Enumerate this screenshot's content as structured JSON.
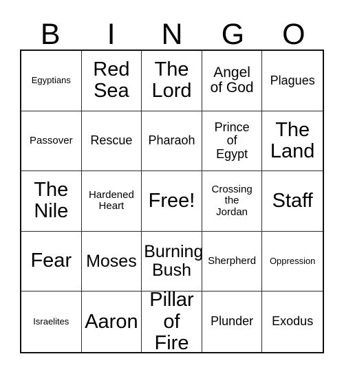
{
  "card": {
    "headers": [
      "B",
      "I",
      "N",
      "G",
      "O"
    ],
    "columns": 5,
    "rows": 5,
    "free_space_label": "Free!",
    "free_space_index": 12,
    "colors": {
      "background": "#ffffff",
      "text": "#000000",
      "outer_border": "#111111",
      "inner_border": "#2b2b2b"
    },
    "cells": [
      {
        "text": "Egyptians",
        "size": "xs"
      },
      {
        "text": "Red\nSea",
        "size": "xxl"
      },
      {
        "text": "The\nLord",
        "size": "xxl"
      },
      {
        "text": "Angel\nof God",
        "size": "lg"
      },
      {
        "text": "Plagues",
        "size": "md"
      },
      {
        "text": "Passover",
        "size": "sm"
      },
      {
        "text": "Rescue",
        "size": "md"
      },
      {
        "text": "Pharaoh",
        "size": "md"
      },
      {
        "text": "Prince\nof\nEgypt",
        "size": "md"
      },
      {
        "text": "The\nLand",
        "size": "xxl"
      },
      {
        "text": "The\nNile",
        "size": "xxl"
      },
      {
        "text": "Hardened\nHeart",
        "size": "sm"
      },
      {
        "text": "Free!",
        "size": "xxl"
      },
      {
        "text": "Crossing\nthe\nJordan",
        "size": "sm"
      },
      {
        "text": "Staff",
        "size": "xxl"
      },
      {
        "text": "Fear",
        "size": "xxl"
      },
      {
        "text": "Moses",
        "size": "xl"
      },
      {
        "text": "Burning\nBush",
        "size": "xl"
      },
      {
        "text": "Sherpherd",
        "size": "sm"
      },
      {
        "text": "Oppression",
        "size": "xs"
      },
      {
        "text": "Israelites",
        "size": "xs"
      },
      {
        "text": "Aaron",
        "size": "xxl"
      },
      {
        "text": "Pillar\nof Fire",
        "size": "xxl"
      },
      {
        "text": "Plunder",
        "size": "md"
      },
      {
        "text": "Exodus",
        "size": "md"
      }
    ]
  }
}
